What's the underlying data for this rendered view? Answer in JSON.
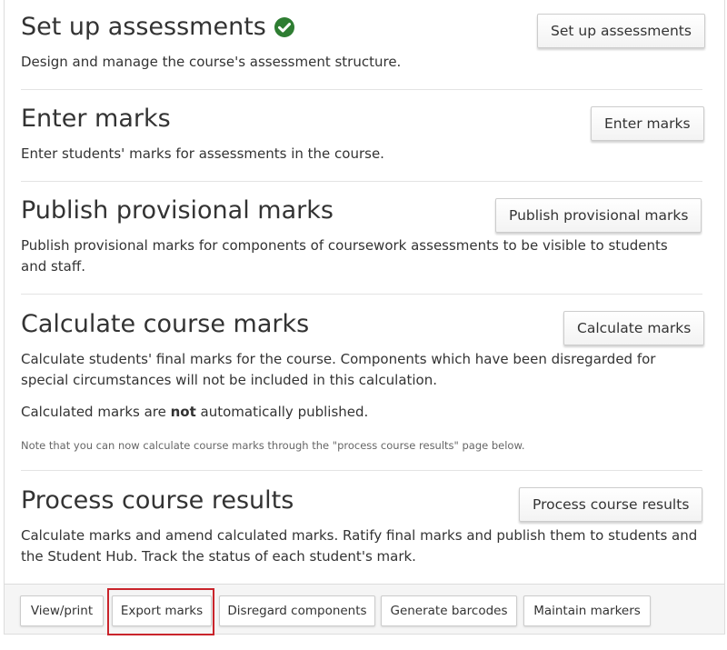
{
  "sections": [
    {
      "title": "Set up assessments",
      "description": "Design and manage the course's assessment structure.",
      "button": "Set up assessments",
      "check_icon": "check-circle-icon",
      "check_color": "#2e7d32"
    },
    {
      "title": "Enter marks",
      "description": "Enter students' marks for assessments in the course.",
      "button": "Enter marks"
    },
    {
      "title": "Publish provisional marks",
      "description": "Publish provisional marks for components of coursework assessments to be visible to students and staff.",
      "button": "Publish provisional marks"
    },
    {
      "title": "Calculate course marks",
      "description": "Calculate students' final marks for the course. Components which have been disregarded for special circumstances will not be included in this calculation.",
      "description2_pre": "Calculated marks are ",
      "description2_bold": "not",
      "description2_post": " automatically published.",
      "note": "Note that you can now calculate course marks through the \"process course results\" page below.",
      "button": "Calculate marks"
    },
    {
      "title": "Process course results",
      "description": "Calculate marks and amend calculated marks. Ratify final marks and publish them to students and the Student Hub. Track the status of each student's mark.",
      "button": "Process course results"
    }
  ],
  "footer": {
    "buttons": [
      "View/print",
      "Export marks",
      "Disregard components",
      "Generate barcodes",
      "Maintain markers"
    ],
    "highlighted": "Export marks",
    "highlight_color": "#c9242b"
  }
}
